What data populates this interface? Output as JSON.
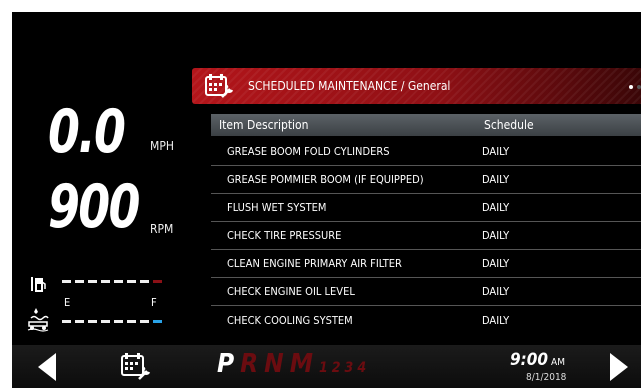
{
  "gauges": {
    "speed": "0.0",
    "speed_unit": "MPH",
    "rpm": "900",
    "rpm_unit": "RPM",
    "tank_empty": "E",
    "tank_full": "F"
  },
  "panel": {
    "title": "SCHEDULED MAINTENANCE / General",
    "col_desc": "Item Description",
    "col_sched": "Schedule",
    "rows": [
      {
        "desc": "GREASE BOOM FOLD CYLINDERS",
        "sched": "DAILY"
      },
      {
        "desc": "GREASE POMMIER BOOM (IF EQUIPPED)",
        "sched": "DAILY"
      },
      {
        "desc": "FLUSH WET SYSTEM",
        "sched": "DAILY"
      },
      {
        "desc": "CHECK TIRE PRESSURE",
        "sched": "DAILY"
      },
      {
        "desc": "CLEAN ENGINE PRIMARY AIR FILTER",
        "sched": "DAILY"
      },
      {
        "desc": "CHECK ENGINE OIL LEVEL",
        "sched": "DAILY"
      },
      {
        "desc": "CHECK COOLING SYSTEM",
        "sched": "DAILY"
      }
    ]
  },
  "bottom": {
    "gear_p": "P",
    "gear_r": "R",
    "gear_n": "N",
    "gear_m": "M",
    "gear_nums": "1234",
    "time": "9:00",
    "ampm": "AM",
    "date": "8/1/2018"
  },
  "colors": {
    "accent_red": "#b3151a",
    "water_blue": "#2aa3e8"
  },
  "icons": [
    "fuel-pump-icon",
    "water-tank-icon",
    "calendar-wrench-icon",
    "arrow-left-icon",
    "arrow-right-icon"
  ]
}
